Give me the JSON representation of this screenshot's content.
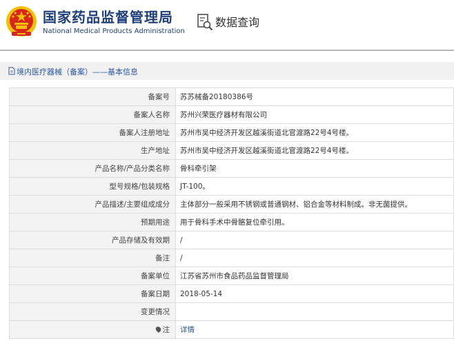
{
  "header": {
    "site_name_cn": "国家药品监督管理局",
    "site_name_en": "National Medical Products Administration",
    "query_title": "数据查询",
    "icons": [
      "emblem-icon",
      "magnifier-document-icon"
    ]
  },
  "breadcrumb": {
    "icon": "document-icon",
    "text": "境内医疗器械（备案）——基本信息"
  },
  "record": {
    "rows": [
      {
        "label": "备案号",
        "value": "苏苏械备20180386号"
      },
      {
        "label": "备案人名称",
        "value": "苏州兴荣医疗器材有限公司"
      },
      {
        "label": "备案人注册地址",
        "value": "苏州市吴中经济开发区越溪街道北官渡路22号4号楼。"
      },
      {
        "label": "生产地址",
        "value": "苏州市吴中经济开发区越溪街道北官渡路22号4号楼。"
      },
      {
        "label": "产品名称/产品分类名称",
        "value": "骨科牵引架"
      },
      {
        "label": "型号规格/包装规格",
        "value": "JT-100。"
      },
      {
        "label": "产品描述/主要组成成分",
        "value": "主体部分一般采用不锈钢或普通钢材、铝合金等材料制成。非无菌提供。"
      },
      {
        "label": "预期用途",
        "value": "用于骨科手术中骨骼复位牵引用。"
      },
      {
        "label": "产品存储及有效期",
        "value": "/"
      },
      {
        "label": "备注",
        "value": "/"
      },
      {
        "label": "备案单位",
        "value": "江苏省苏州市食品药品监督管理局"
      },
      {
        "label": "备案日期",
        "value": "2018-05-14"
      },
      {
        "label": "变更情况",
        "value": ""
      }
    ],
    "note": {
      "label": "注",
      "icon": "pin-icon",
      "link_text": "详情"
    }
  },
  "colors": {
    "brand_blue": "#1f3f7a",
    "link_blue": "#2a55a6",
    "emblem_red": "#d8261b",
    "emblem_gold": "#f2c200"
  }
}
